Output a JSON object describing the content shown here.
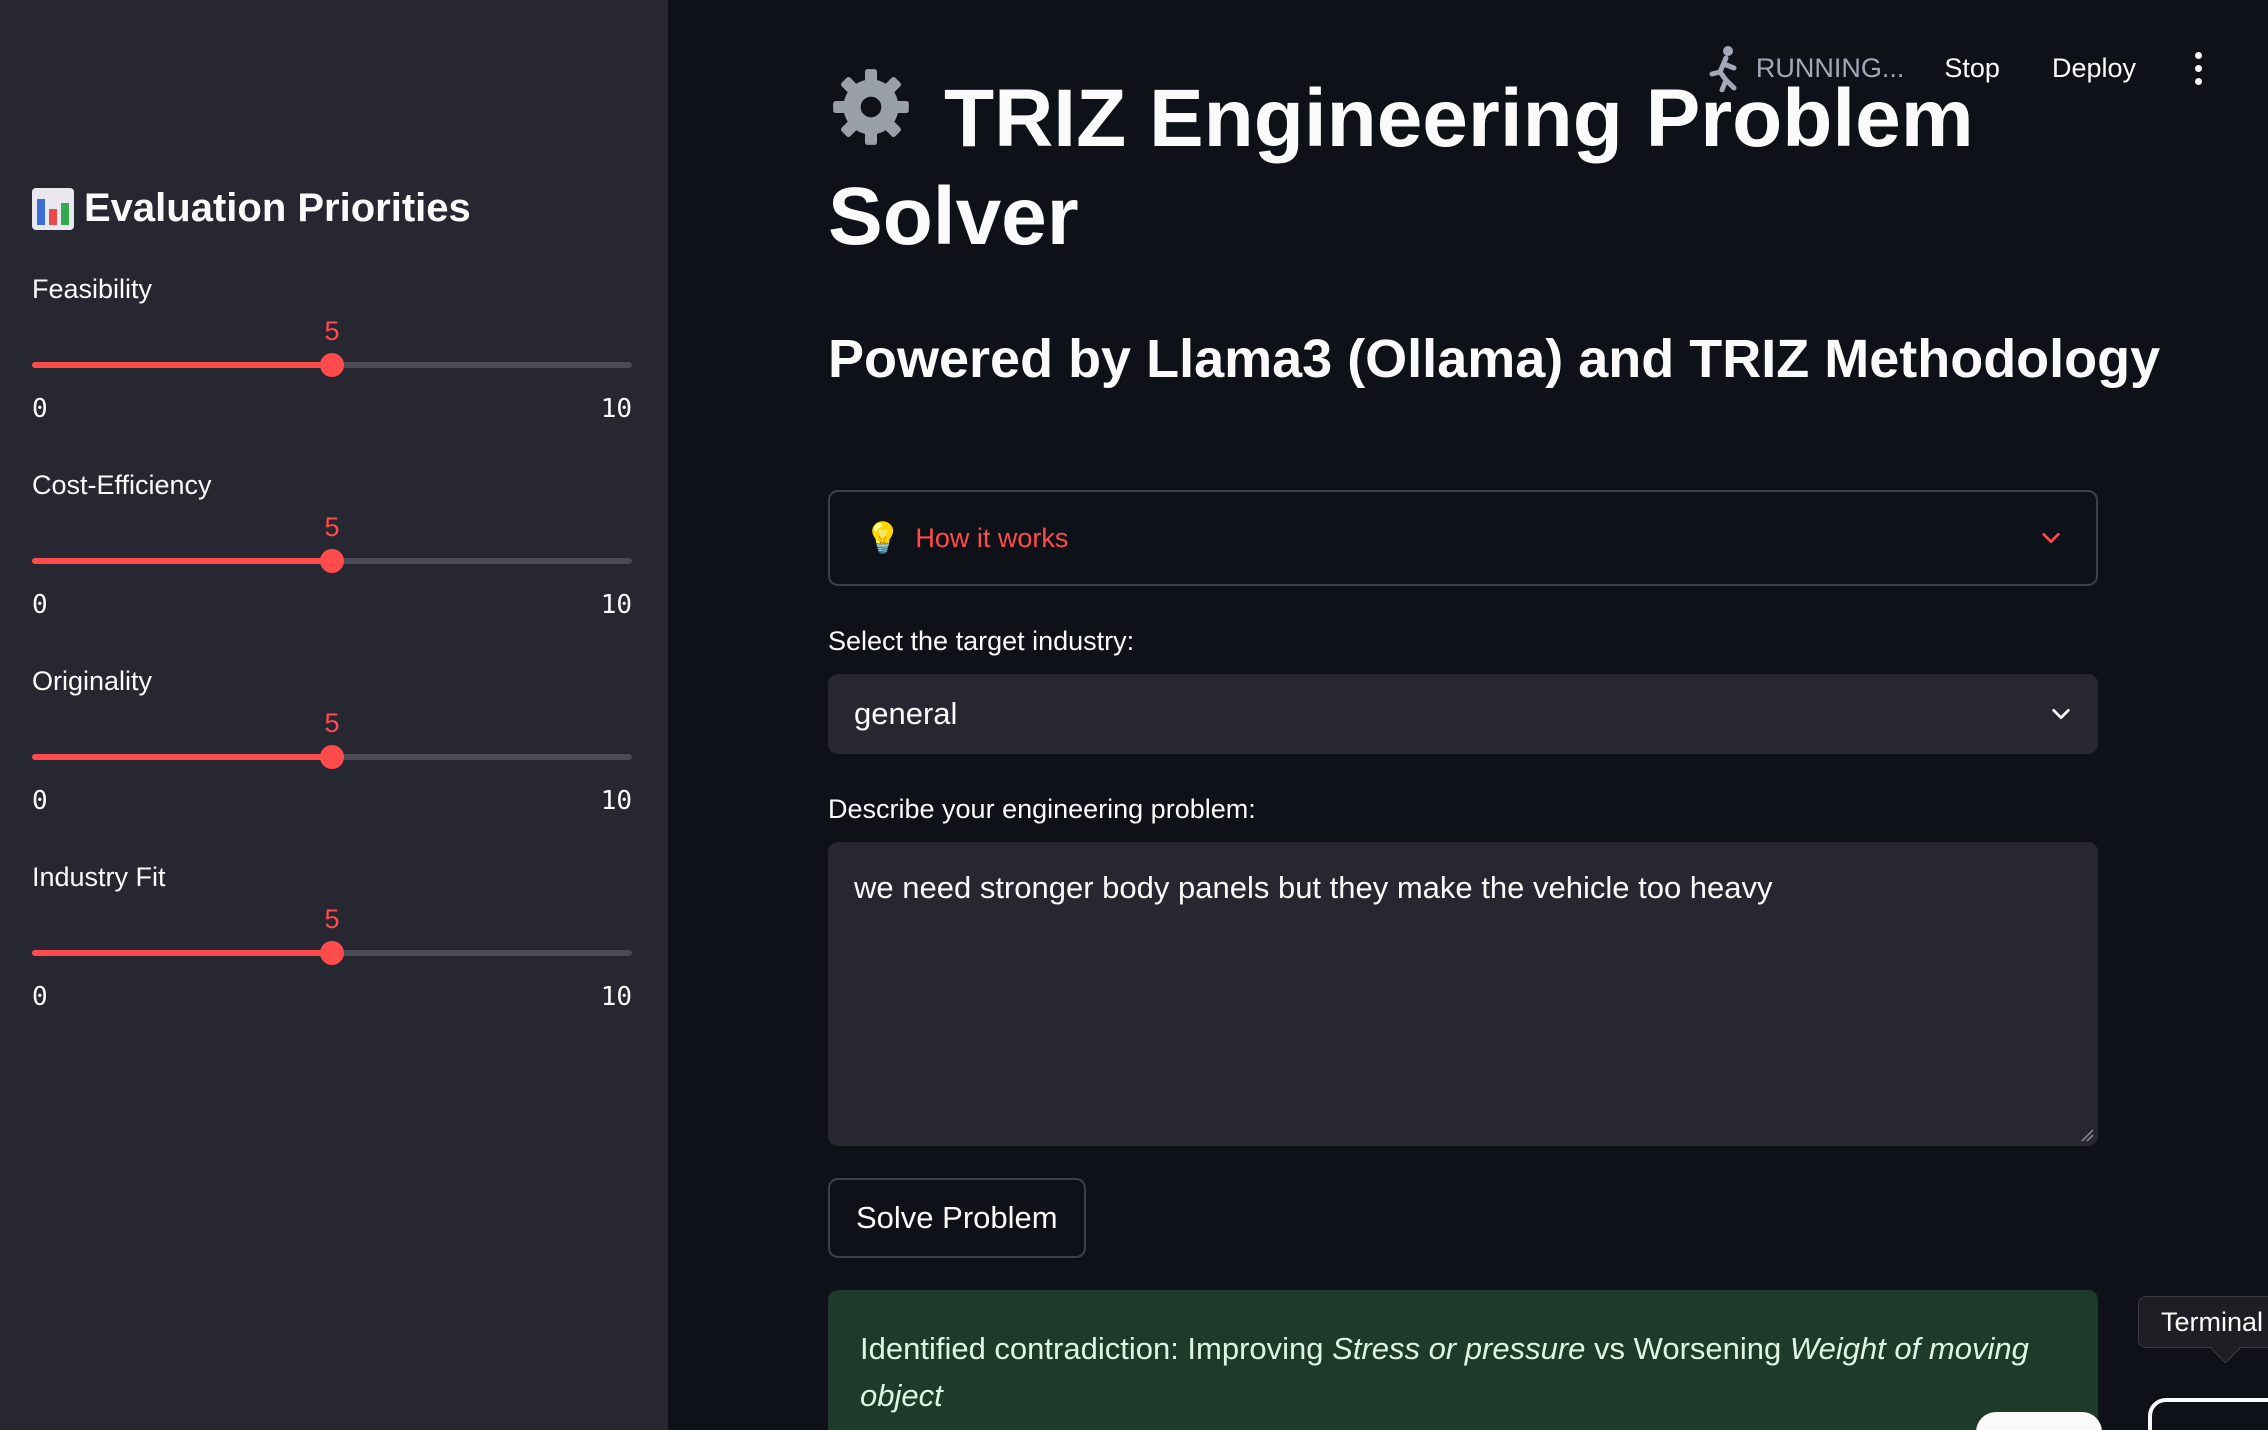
{
  "sidebar": {
    "title": "Evaluation Priorities",
    "icon": "bar-chart-icon",
    "sliders": [
      {
        "label": "Feasibility",
        "value": "5",
        "min": "0",
        "max": "10",
        "fraction": 0.5
      },
      {
        "label": "Cost-Efficiency",
        "value": "5",
        "min": "0",
        "max": "10",
        "fraction": 0.5
      },
      {
        "label": "Originality",
        "value": "5",
        "min": "0",
        "max": "10",
        "fraction": 0.5
      },
      {
        "label": "Industry Fit",
        "value": "5",
        "min": "0",
        "max": "10",
        "fraction": 0.5
      }
    ]
  },
  "toolbar": {
    "status": "RUNNING...",
    "stop_label": "Stop",
    "deploy_label": "Deploy"
  },
  "main": {
    "title_line1": "TRIZ Engineering Problem",
    "title_line2": "Solver",
    "subtitle": "Powered by Llama3 (Ollama) and TRIZ Methodology",
    "expander_label": "How it works",
    "industry_label": "Select the target industry:",
    "industry_value": "general",
    "problem_label": "Describe your engineering problem:",
    "problem_text": "we need stronger body panels but they make the vehicle too heavy",
    "solve_label": "Solve Problem",
    "alert": {
      "prefix": "Identified contradiction: Improving ",
      "improving": "Stress or pressure",
      "middle": " vs Worsening ",
      "worsening": "Weight of moving object"
    }
  },
  "tooltip": "Terminal",
  "colors": {
    "accent": "#ff4b4b",
    "background": "#0e1117",
    "sidebar": "#262730",
    "success_bg": "#1d3a2a"
  }
}
